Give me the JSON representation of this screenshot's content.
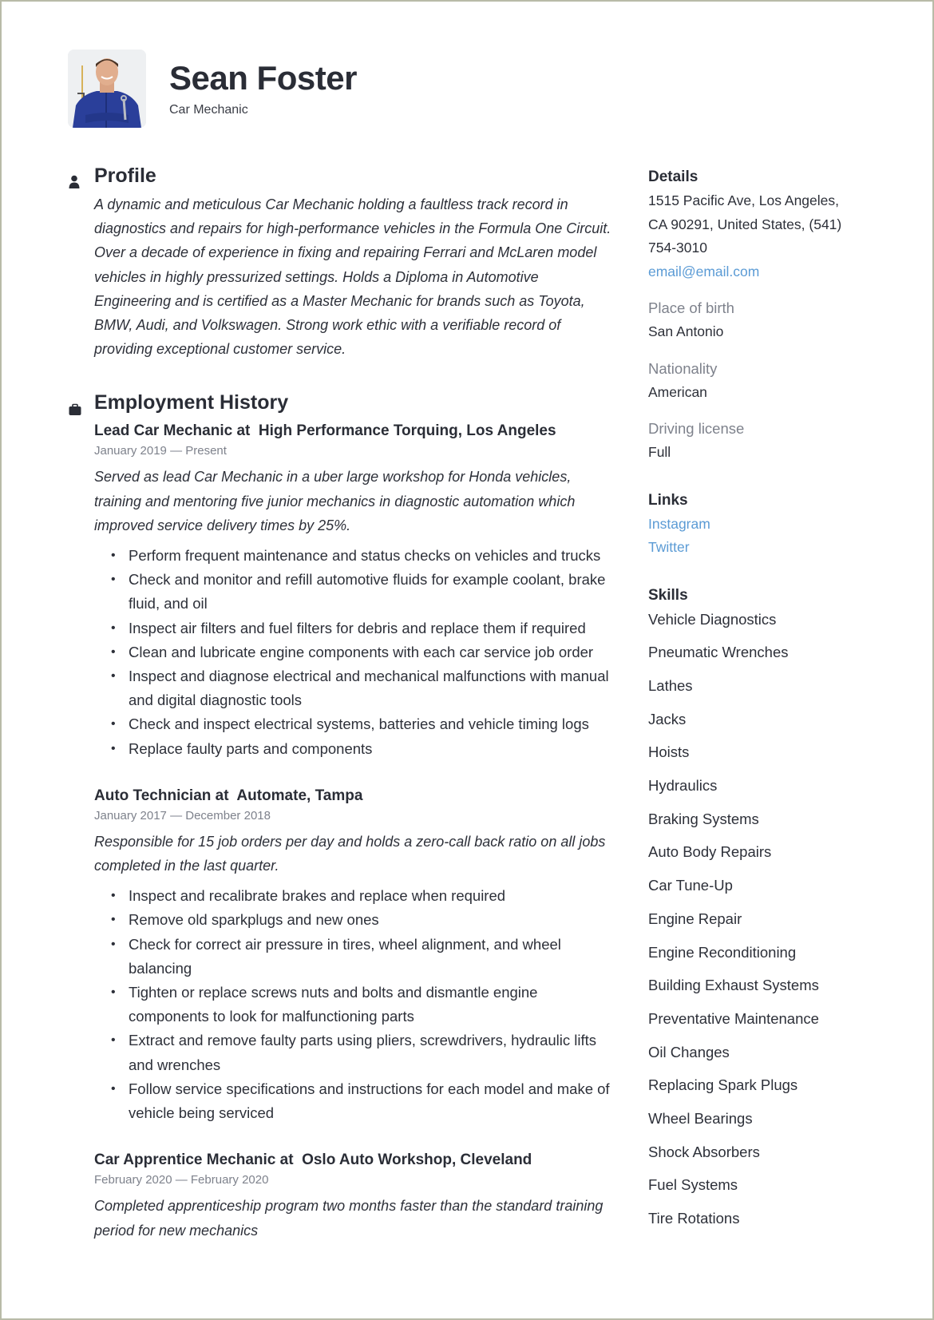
{
  "header": {
    "name": "Sean Foster",
    "job_title": "Car Mechanic",
    "photo_alt": "Portrait of a smiling mechanic in blue overalls"
  },
  "profile": {
    "heading": "Profile",
    "icon": "person-icon",
    "text": "A dynamic and meticulous Car Mechanic holding a faultless track record in diagnostics and repairs for high-performance vehicles in the Formula One Circuit. Over a decade of experience in fixing and repairing Ferrari and McLaren model vehicles in highly pressurized settings. Holds a Diploma in Automotive Engineering and is certified as a Master Mechanic for brands such as Toyota, BMW, Audi, and Volkswagen.  Strong work ethic with a verifiable record of providing exceptional customer service."
  },
  "employment": {
    "heading": "Employment History",
    "icon": "briefcase-icon",
    "jobs": [
      {
        "title": "Lead Car Mechanic at  High Performance Torquing, Los Angeles",
        "dates": "January 2019 — Present",
        "summary": "Served as lead Car Mechanic in a uber large workshop for Honda vehicles, training and mentoring five junior mechanics in diagnostic automation which improved service delivery times by 25%.",
        "bullets": [
          "Perform frequent maintenance and status checks on vehicles and trucks",
          "Check and monitor and refill automotive fluids for example coolant, brake fluid, and oil",
          "Inspect air filters and fuel filters for debris and replace them if required",
          "Clean and lubricate engine components with each car service job order",
          "Inspect and diagnose electrical and mechanical malfunctions with manual and digital diagnostic tools",
          "Check and inspect electrical systems, batteries and vehicle timing logs",
          "Replace faulty parts and components"
        ]
      },
      {
        "title": "Auto Technician at  Automate, Tampa",
        "dates": "January 2017 — December 2018",
        "summary": "Responsible for 15 job orders per day and holds a zero-call back ratio on all jobs completed in the last quarter.",
        "bullets": [
          "Inspect and recalibrate brakes and replace when required",
          "Remove old sparkplugs and new ones",
          "Check for correct air pressure in tires, wheel alignment, and wheel balancing",
          "Tighten or replace screws nuts and bolts and dismantle engine components to look for malfunctioning parts",
          "Extract and remove faulty parts using pliers, screwdrivers, hydraulic lifts and wrenches",
          "Follow service specifications and instructions for each model and make of vehicle being serviced"
        ]
      },
      {
        "title": "Car Apprentice Mechanic at  Oslo Auto Workshop, Cleveland",
        "dates": "February 2020 — February 2020",
        "summary": "Completed apprenticeship program two months faster than the standard training period for new mechanics",
        "bullets": []
      }
    ]
  },
  "details": {
    "heading": "Details",
    "address_line1": "1515 Pacific Ave, Los Angeles,",
    "address_line2": "CA 90291, United States, (541)",
    "address_line3": "754-3010",
    "email": "email@email.com",
    "place_of_birth_label": "Place of birth",
    "place_of_birth": "San Antonio",
    "nationality_label": "Nationality",
    "nationality": "American",
    "driving_license_label": "Driving license",
    "driving_license": "Full"
  },
  "links": {
    "heading": "Links",
    "items": [
      "Instagram",
      "Twitter"
    ]
  },
  "skills": {
    "heading": "Skills",
    "items": [
      "Vehicle Diagnostics",
      "Pneumatic Wrenches",
      "Lathes",
      "Jacks",
      "Hoists",
      "Hydraulics",
      "Braking Systems",
      "Auto Body Repairs",
      "Car Tune-Up",
      "Engine Repair",
      "Engine Reconditioning",
      "Building Exhaust Systems",
      "Preventative Maintenance",
      "Oil Changes",
      "Replacing Spark Plugs",
      "Wheel Bearings",
      "Shock Absorbers",
      "Fuel Systems",
      "Tire Rotations"
    ]
  },
  "colors": {
    "text": "#2d3039",
    "muted": "#7e828c",
    "link": "#5b9bd5",
    "border": "#b9bba8"
  }
}
